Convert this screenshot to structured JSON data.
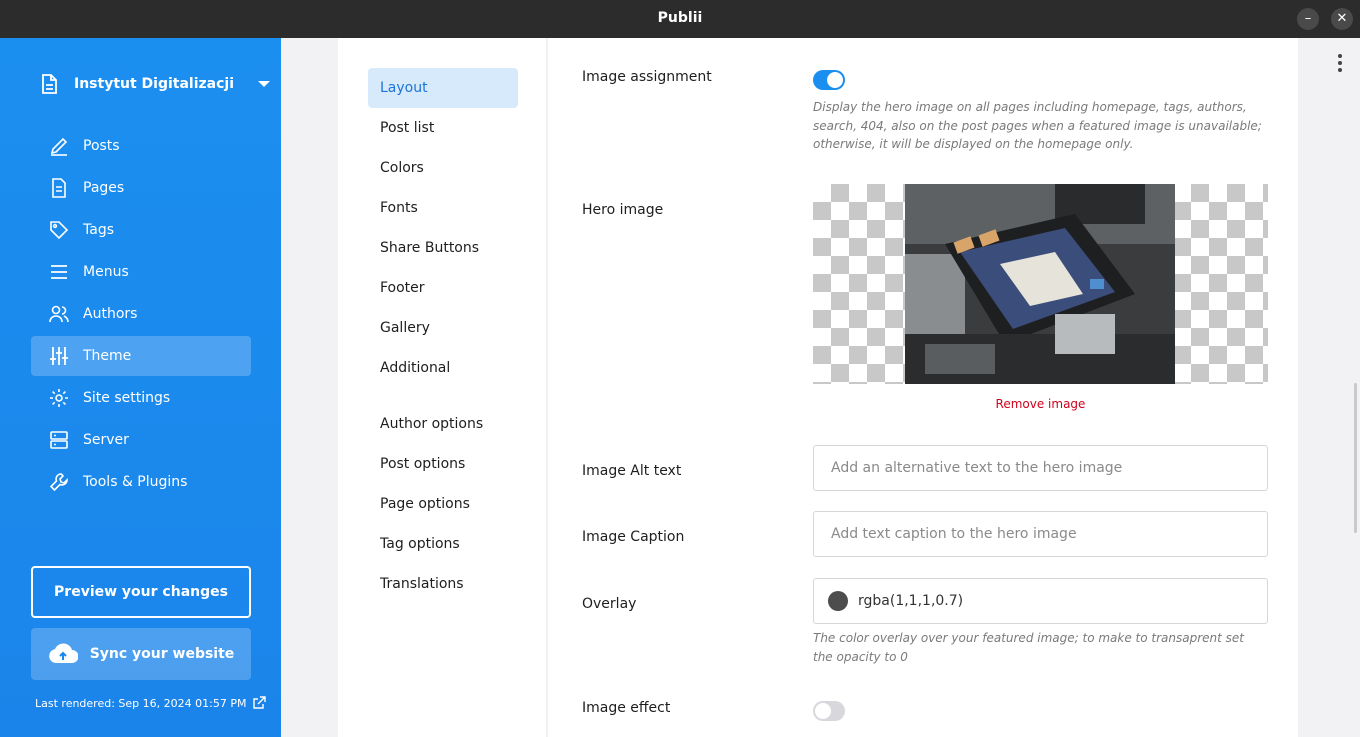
{
  "window": {
    "title": "Publii",
    "minimize_glyph": "–",
    "close_glyph": "✕"
  },
  "sidebar": {
    "site_name": "Instytut Digitalizacji",
    "items": [
      {
        "label": "Posts",
        "icon": "pen-icon"
      },
      {
        "label": "Pages",
        "icon": "page-icon"
      },
      {
        "label": "Tags",
        "icon": "tag-icon"
      },
      {
        "label": "Menus",
        "icon": "menu-icon"
      },
      {
        "label": "Authors",
        "icon": "users-icon"
      },
      {
        "label": "Theme",
        "icon": "sliders-icon",
        "active": true
      },
      {
        "label": "Site settings",
        "icon": "gear-icon"
      },
      {
        "label": "Server",
        "icon": "server-icon"
      },
      {
        "label": "Tools & Plugins",
        "icon": "wrench-icon"
      }
    ],
    "preview_label": "Preview your changes",
    "sync_label": "Sync your website",
    "last_rendered": "Last rendered: Sep 16, 2024 01:57 PM"
  },
  "subnav": {
    "items": [
      "Layout",
      "Post list",
      "Colors",
      "Fonts",
      "Share Buttons",
      "Footer",
      "Gallery",
      "Additional"
    ],
    "options": [
      "Author options",
      "Post options",
      "Page options",
      "Tag options",
      "Translations"
    ],
    "active": "Layout"
  },
  "form": {
    "image_assignment": {
      "label": "Image assignment",
      "enabled": true,
      "help": "Display the hero image on all pages including homepage, tags, authors, search, 404, also on the post pages when a featured image is unavailable; otherwise, it will be displayed on the homepage only."
    },
    "hero_image": {
      "label": "Hero image",
      "remove_label": "Remove image"
    },
    "alt_text": {
      "label": "Image Alt text",
      "placeholder": "Add an alternative text to the hero image",
      "value": ""
    },
    "caption": {
      "label": "Image Caption",
      "placeholder": "Add text caption to the hero image",
      "value": ""
    },
    "overlay": {
      "label": "Overlay",
      "value": "rgba(1,1,1,0.7)",
      "help": "The color overlay over your featured image; to make to transaprent set the opacity to 0"
    },
    "image_effect": {
      "label": "Image effect",
      "enabled": false
    }
  },
  "colors": {
    "accent": "#1b8ff0",
    "sidebar": "#1b88ee",
    "danger": "#d0021b",
    "active_subnav_bg": "#d7eafc"
  }
}
